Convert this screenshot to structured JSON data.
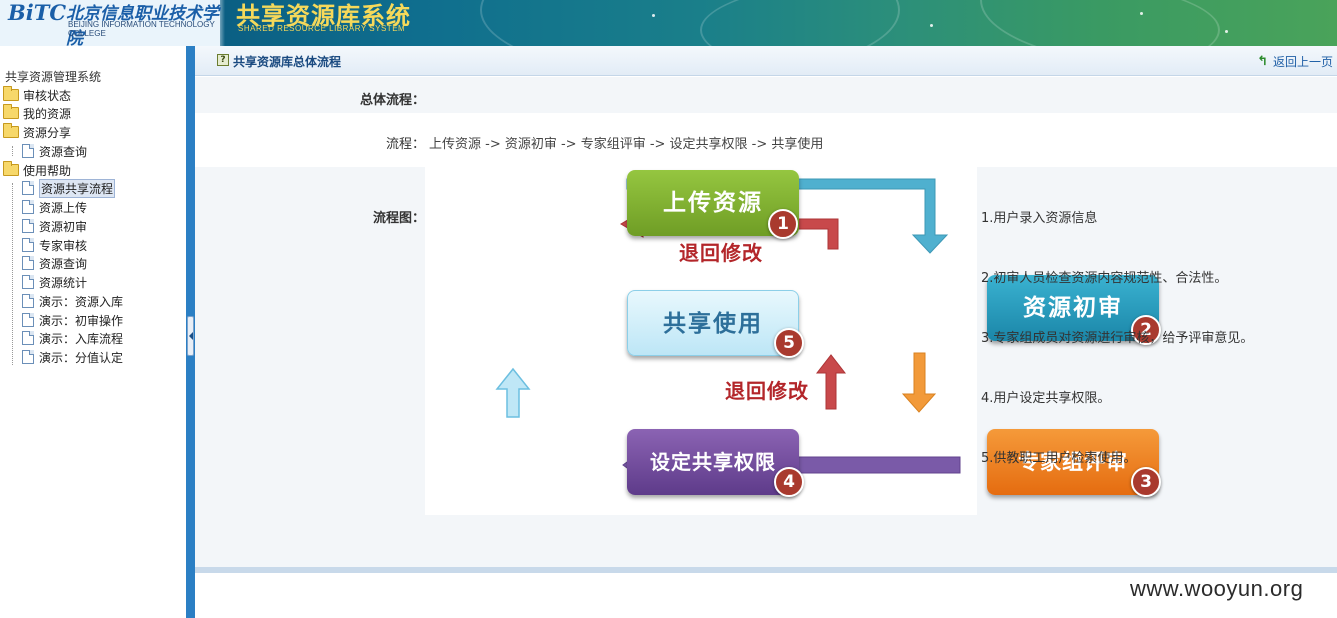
{
  "header": {
    "logo_text": "BiTC",
    "college_cn": "北京信息职业技术学院",
    "college_en": "BEIJING INFORMATION TECHNOLOGY COLLEGE",
    "system_title_cn": "共享资源库系统",
    "system_title_en": "SHARED RESOURCE LIBRARY SYSTEM"
  },
  "sidebar": {
    "root": "共享资源管理系统",
    "folders": [
      {
        "label": "审核状态"
      },
      {
        "label": "我的资源"
      },
      {
        "label": "资源分享",
        "children": [
          {
            "label": "资源查询"
          }
        ]
      },
      {
        "label": "使用帮助",
        "children": [
          {
            "label": "资源共享流程",
            "selected": true
          },
          {
            "label": "资源上传"
          },
          {
            "label": "资源初审"
          },
          {
            "label": "专家审核"
          },
          {
            "label": "资源查询"
          },
          {
            "label": "资源统计"
          },
          {
            "label": "演示：资源入库"
          },
          {
            "label": "演示：初审操作"
          },
          {
            "label": "演示：入库流程"
          },
          {
            "label": "演示：分值认定"
          }
        ]
      }
    ]
  },
  "main": {
    "title": "共享资源库总体流程",
    "back_link": "返回上一页",
    "overall_label": "总体流程：",
    "process_label": "流程：",
    "process_text": "上传资源 -> 资源初审 -> 专家组评审 -> 设定共享权限 -> 共享使用",
    "diagram_label": "流程图：",
    "diagram": {
      "boxes": [
        {
          "label": "上传资源",
          "number": "1",
          "color": "#7dab2a"
        },
        {
          "label": "资源初审",
          "number": "2",
          "color": "#2497b9"
        },
        {
          "label": "专家组评审",
          "number": "3",
          "color": "#ee7a1a"
        },
        {
          "label": "设定共享权限",
          "number": "4",
          "color": "#6b4a9a"
        },
        {
          "label": "共享使用",
          "number": "5",
          "color": "#cfeef9"
        }
      ],
      "return_label_1": "退回修改",
      "return_label_2": "退回修改"
    },
    "steps": [
      "1.用户录入资源信息",
      "2.初审人员检查资源内容规范性、合法性。",
      "3.专家组成员对资源进行审核，给予评审意见。",
      "4.用户设定共享权限。",
      "5.供教职工用户检索使用。"
    ]
  },
  "watermark": "www.wooyun.org"
}
